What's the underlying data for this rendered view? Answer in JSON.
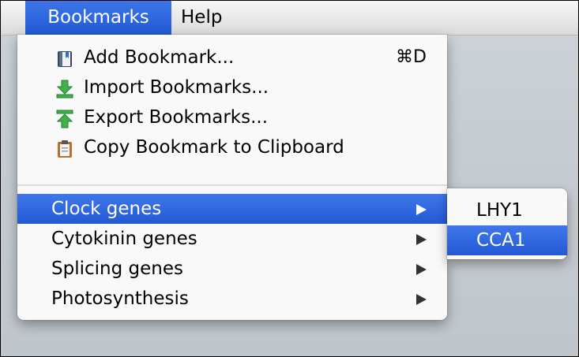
{
  "menubar": {
    "items": [
      {
        "label": "Bookmarks",
        "active": true
      },
      {
        "label": "Help",
        "active": false
      }
    ]
  },
  "bookmarks_menu": {
    "actions": [
      {
        "label": "Add Bookmark...",
        "icon": "bookmark-book-icon",
        "shortcut": "⌘D"
      },
      {
        "label": "Import Bookmarks...",
        "icon": "import-arrow-down-icon",
        "shortcut": ""
      },
      {
        "label": "Export Bookmarks...",
        "icon": "export-arrow-up-icon",
        "shortcut": ""
      },
      {
        "label": "Copy Bookmark to Clipboard",
        "icon": "clipboard-icon",
        "shortcut": ""
      }
    ],
    "folders": [
      {
        "label": "Clock genes",
        "selected": true
      },
      {
        "label": "Cytokinin genes",
        "selected": false
      },
      {
        "label": "Splicing genes",
        "selected": false
      },
      {
        "label": "Photosynthesis",
        "selected": false
      }
    ]
  },
  "submenu": {
    "items": [
      {
        "label": "LHY1",
        "selected": false
      },
      {
        "label": "CCA1",
        "selected": true
      }
    ]
  },
  "colors": {
    "selection": "#2a5fdb",
    "menu_background": "#fafafa",
    "desktop": "#c6ccd1"
  }
}
